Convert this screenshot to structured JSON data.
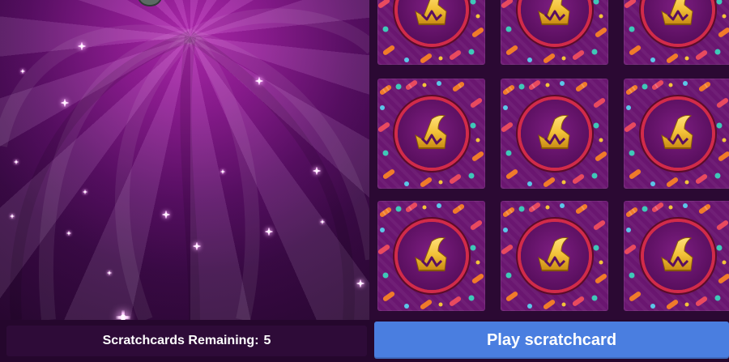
{
  "footer": {
    "remaining_label": "Scratchcards Remaining:",
    "remaining_count": "5",
    "play_button_label": "Play scratchcard"
  },
  "grid": {
    "rows": 3,
    "columns": 3,
    "card_icon": "witch-hat-crown-icon",
    "card_pattern": "candy-pattern"
  },
  "background": {
    "scene": "purple-swirl-with-sparkles",
    "sparkle_icon": "sparkle-icon"
  },
  "colors": {
    "play_button": "#4a7ee0",
    "card_base": "#6a1670",
    "emblem_ring": "#d12b4a",
    "hat_gold": "#f3c33a",
    "panel_dark": "#2e0b38"
  }
}
